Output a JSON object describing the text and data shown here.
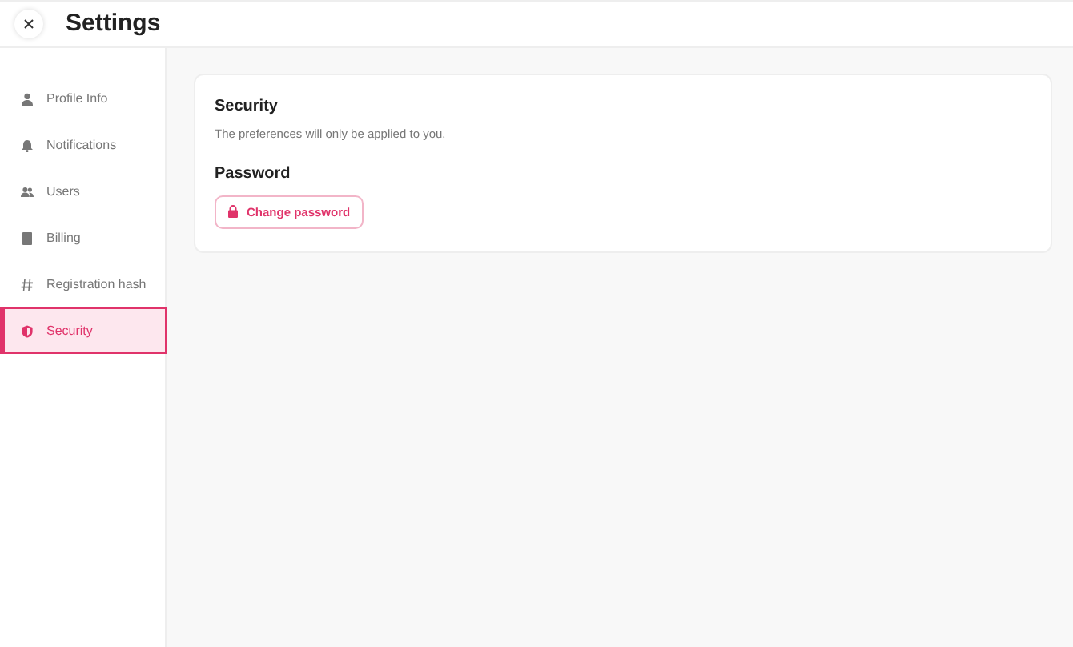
{
  "header": {
    "title": "Settings"
  },
  "sidebar": {
    "items": [
      {
        "label": "Profile Info",
        "selected": false
      },
      {
        "label": "Notifications",
        "selected": false
      },
      {
        "label": "Users",
        "selected": false
      },
      {
        "label": "Billing",
        "selected": false
      },
      {
        "label": "Registration hash",
        "selected": false
      },
      {
        "label": "Security",
        "selected": true
      }
    ]
  },
  "panel": {
    "title": "Security",
    "description": "The preferences will only be applied to you.",
    "section_title": "Password",
    "button": "Change password"
  }
}
